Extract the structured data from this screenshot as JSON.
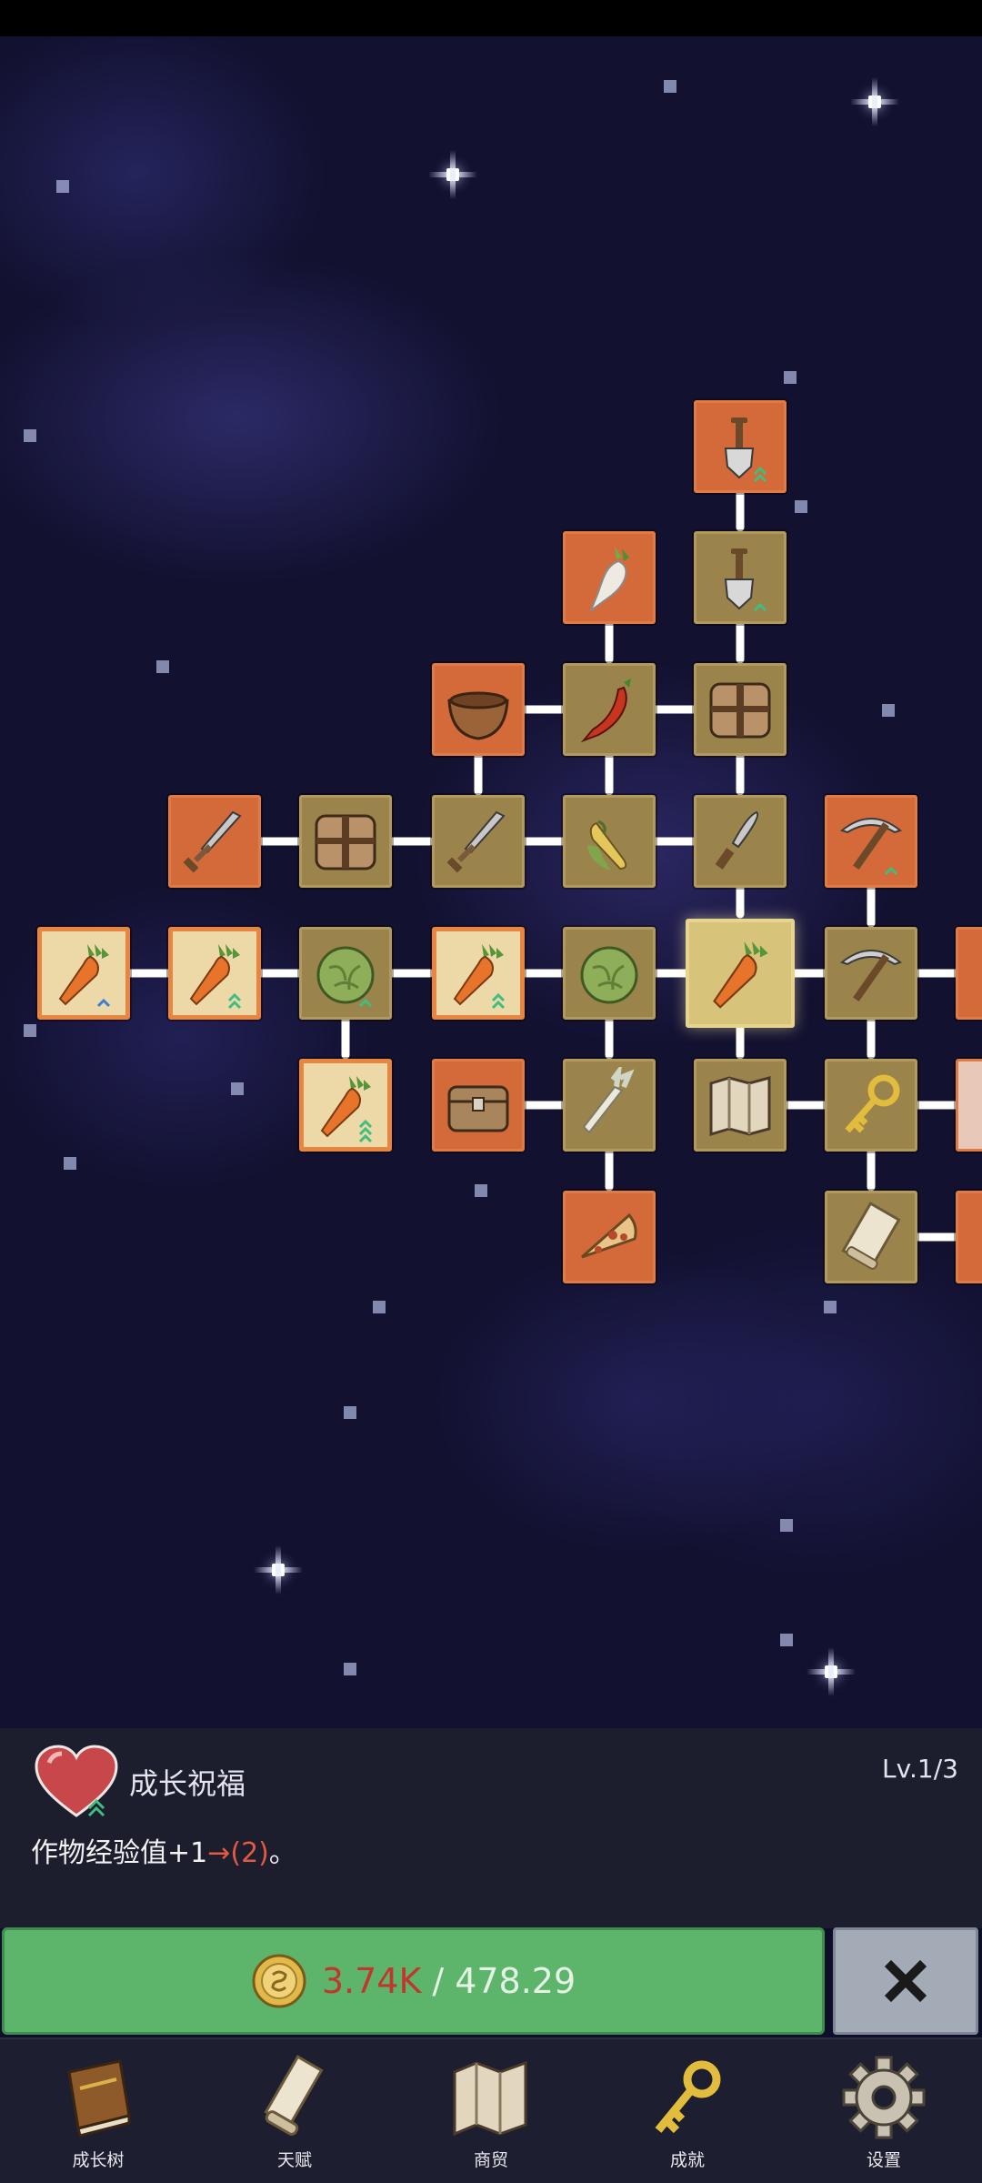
{
  "skill_panel": {
    "name": "成长祝福",
    "level": "Lv.1/3",
    "description_base": "作物经验值+1",
    "description_upgrade": "→(2)",
    "description_end": "。",
    "icon": "heart-icon"
  },
  "upgrade_button": {
    "cost": "3.74K",
    "separator": "/",
    "balance": "478.29",
    "icon": "coin-icon"
  },
  "close_button": {
    "icon": "close-icon"
  },
  "nav": {
    "tabs": [
      {
        "label": "成长树",
        "icon": "book-icon"
      },
      {
        "label": "天赋",
        "icon": "scroll-icon"
      },
      {
        "label": "商贸",
        "icon": "map-icon"
      },
      {
        "label": "成就",
        "icon": "key-icon"
      },
      {
        "label": "设置",
        "icon": "gear-icon"
      }
    ]
  },
  "colors": {
    "node_unlocked": "#d4693a",
    "node_owned": "#9b844c",
    "node_selected": "#d8c37b",
    "upgrade_green": "#5cb56b",
    "cost_red": "#c1372d"
  }
}
